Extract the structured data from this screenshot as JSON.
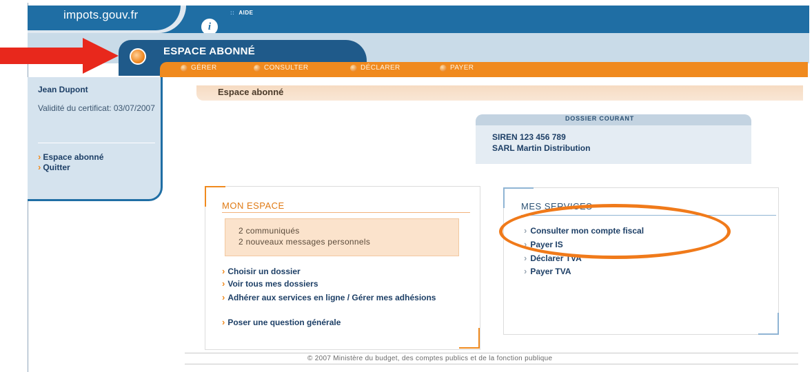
{
  "site": {
    "logo_text": "impots.gouv.fr",
    "badge_letter": "i",
    "help_label": "AIDE"
  },
  "header": {
    "espace_title": "ESPACE ABONNÉ"
  },
  "nav": {
    "items": [
      {
        "label": "GÉRER"
      },
      {
        "label": "CONSULTER"
      },
      {
        "label": "DÉCLARER"
      },
      {
        "label": "PAYER"
      }
    ]
  },
  "sidebar": {
    "user_name": "Jean Dupont",
    "validity": "Validité du certificat: 03/07/2007",
    "links": [
      {
        "label": "Espace abonné"
      },
      {
        "label": "Quitter"
      }
    ]
  },
  "breadcrumb": {
    "title": "Espace abonné"
  },
  "dossier": {
    "title": "DOSSIER COURANT",
    "siren": "SIREN 123 456 789",
    "company": "SARL Martin Distribution"
  },
  "mon_espace": {
    "title": "MON ESPACE",
    "notices": [
      "2 communiqués",
      "2 nouveaux messages personnels"
    ],
    "links": [
      {
        "label": "Choisir un dossier"
      },
      {
        "label": "Voir tous mes dossiers"
      },
      {
        "label": "Adhérer aux services en ligne / Gérer mes adhésions"
      },
      {
        "label": "Poser une question générale"
      }
    ]
  },
  "mes_services": {
    "title": "MES SERVICES",
    "links": [
      {
        "label": "Consulter mon compte fiscal"
      },
      {
        "label": "Payer IS"
      },
      {
        "label": "Déclarer TVA"
      },
      {
        "label": "Payer TVA"
      }
    ]
  },
  "footer": {
    "text": "© 2007 Ministère du budget, des comptes publics et de la fonction publique"
  },
  "colors": {
    "accent_orange": "#f08a1e",
    "brand_blue": "#1f6ea4",
    "annotation_red": "#e8281c"
  }
}
